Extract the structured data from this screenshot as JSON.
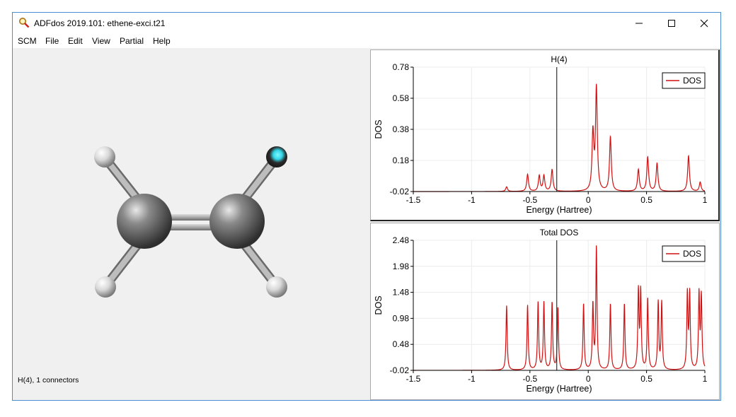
{
  "window": {
    "title": "ADFdos 2019.101: ethene-exci.t21",
    "app_icon": "magnifier-icon",
    "controls": [
      "minimize-icon",
      "maximize-icon",
      "close-icon"
    ]
  },
  "menu": [
    "SCM",
    "File",
    "Edit",
    "View",
    "Partial",
    "Help"
  ],
  "viewer": {
    "status": "H(4), 1 connectors",
    "selected_atom": "H(4)",
    "selection_color": "#33d6e6"
  },
  "chart_data": [
    {
      "type": "line",
      "title": "H(4)",
      "xlabel": "Energy (Hartree)",
      "ylabel": "DOS",
      "xlim": [
        -1.5,
        1
      ],
      "ylim": [
        -0.02,
        0.78
      ],
      "xticks": [
        "-1.5",
        "-1",
        "-0.5",
        "0",
        "0.5",
        "1"
      ],
      "yticks": [
        "-0.02",
        "0.18",
        "0.38",
        "0.58",
        "0.78"
      ],
      "vline_x": -0.27,
      "legend": "top-right",
      "grid": true,
      "series": [
        {
          "name": "DOS",
          "color": "#d01010",
          "peaks": [
            {
              "x": -0.7,
              "h": 0.03
            },
            {
              "x": -0.52,
              "h": 0.11
            },
            {
              "x": -0.42,
              "h": 0.1
            },
            {
              "x": -0.38,
              "h": 0.1
            },
            {
              "x": -0.31,
              "h": 0.14
            },
            {
              "x": 0.04,
              "h": 0.37
            },
            {
              "x": 0.07,
              "h": 0.66
            },
            {
              "x": 0.19,
              "h": 0.35
            },
            {
              "x": 0.43,
              "h": 0.14
            },
            {
              "x": 0.51,
              "h": 0.22
            },
            {
              "x": 0.59,
              "h": 0.18
            },
            {
              "x": 0.86,
              "h": 0.23
            },
            {
              "x": 0.96,
              "h": 0.06
            }
          ]
        }
      ]
    },
    {
      "type": "line",
      "title": "Total DOS",
      "xlabel": "Energy (Hartree)",
      "ylabel": "DOS",
      "xlim": [
        -1.5,
        1
      ],
      "ylim": [
        -0.02,
        2.48
      ],
      "xticks": [
        "-1.5",
        "-1",
        "-0.5",
        "0",
        "0.5",
        "1"
      ],
      "yticks": [
        "-0.02",
        "0.48",
        "0.98",
        "1.48",
        "1.98",
        "2.48"
      ],
      "vline_x": -0.27,
      "legend": "top-right",
      "grid": true,
      "series": [
        {
          "name": "DOS",
          "color": "#d01010",
          "peaks": [
            {
              "x": -0.7,
              "h": 1.24
            },
            {
              "x": -0.52,
              "h": 1.25
            },
            {
              "x": -0.43,
              "h": 1.3
            },
            {
              "x": -0.38,
              "h": 1.3
            },
            {
              "x": -0.31,
              "h": 1.3
            },
            {
              "x": -0.26,
              "h": 1.2
            },
            {
              "x": -0.04,
              "h": 1.28
            },
            {
              "x": 0.04,
              "h": 1.25
            },
            {
              "x": 0.07,
              "h": 2.35
            },
            {
              "x": 0.19,
              "h": 1.28
            },
            {
              "x": 0.31,
              "h": 1.28
            },
            {
              "x": 0.43,
              "h": 1.5
            },
            {
              "x": 0.45,
              "h": 1.48
            },
            {
              "x": 0.51,
              "h": 1.38
            },
            {
              "x": 0.6,
              "h": 1.3
            },
            {
              "x": 0.63,
              "h": 1.3
            },
            {
              "x": 0.85,
              "h": 1.45
            },
            {
              "x": 0.87,
              "h": 1.45
            },
            {
              "x": 0.95,
              "h": 1.45
            },
            {
              "x": 0.97,
              "h": 1.4
            }
          ]
        }
      ]
    }
  ]
}
